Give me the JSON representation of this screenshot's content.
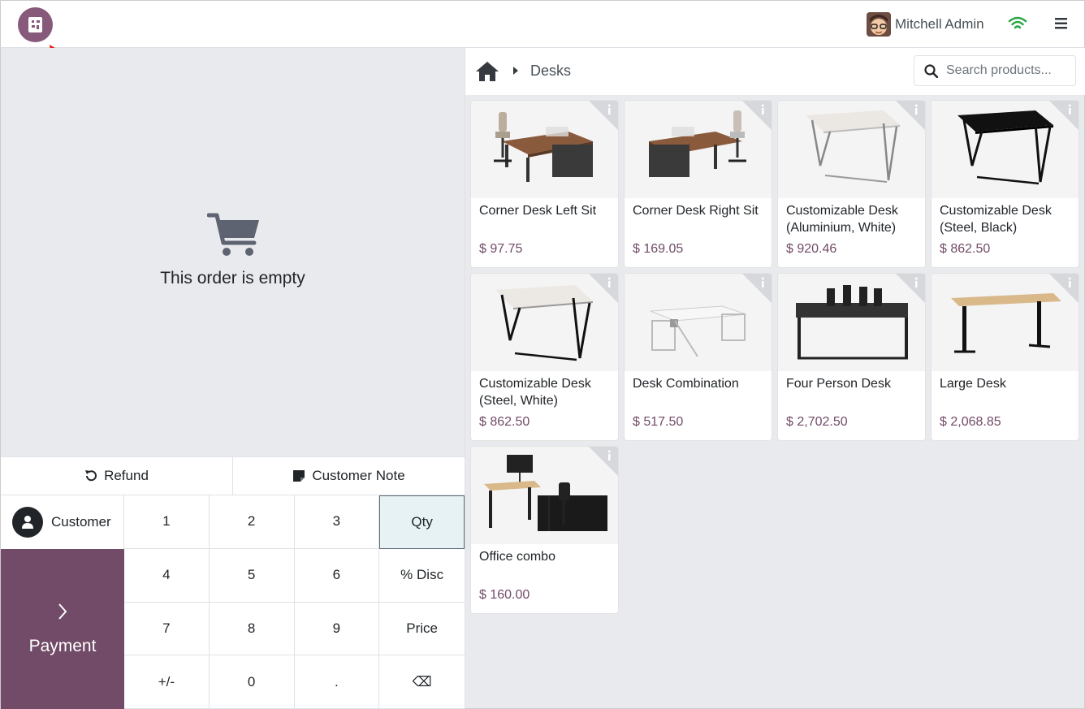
{
  "topbar": {
    "logo_text": "POS",
    "user_name": "Mitchell Admin",
    "icons": [
      "logo-icon",
      "user-avatar",
      "wifi-icon",
      "menu-icon"
    ]
  },
  "order": {
    "empty_message": "This order is empty"
  },
  "actions": {
    "refund": "Refund",
    "customer_note": "Customer Note"
  },
  "numpad": {
    "customer": "Customer",
    "payment": "Payment",
    "keys": [
      "1",
      "2",
      "3",
      "Qty",
      "4",
      "5",
      "6",
      "% Disc",
      "7",
      "8",
      "9",
      "Price",
      "+/-",
      "0",
      ".",
      "⌫"
    ],
    "active_mode": "Qty"
  },
  "products_header": {
    "breadcrumb": "Desks",
    "search_placeholder": "Search products..."
  },
  "products": [
    {
      "name": "Corner Desk Left Sit",
      "price": "$ 97.75",
      "image": "corner-desk-left"
    },
    {
      "name": "Corner Desk Right Sit",
      "price": "$ 169.05",
      "image": "corner-desk-right"
    },
    {
      "name": "Customizable Desk (Aluminium, White)",
      "price": "$ 920.46",
      "image": "desk-white-alu"
    },
    {
      "name": "Customizable Desk (Steel, Black)",
      "price": "$ 862.50",
      "image": "desk-black"
    },
    {
      "name": "Customizable Desk (Steel, White)",
      "price": "$ 862.50",
      "image": "desk-white-steel"
    },
    {
      "name": "Desk Combination",
      "price": "$ 517.50",
      "image": "desk-combination"
    },
    {
      "name": "Four Person Desk",
      "price": "$ 2,702.50",
      "image": "four-person-desk"
    },
    {
      "name": "Large Desk",
      "price": "$ 2,068.85",
      "image": "large-desk"
    },
    {
      "name": "Office combo",
      "price": "$ 160.00",
      "image": "office-combo"
    }
  ],
  "colors": {
    "brand": "#714b67",
    "logo": "#875a7b",
    "background": "#e9eaed",
    "active_key": "#e6f2f3"
  }
}
